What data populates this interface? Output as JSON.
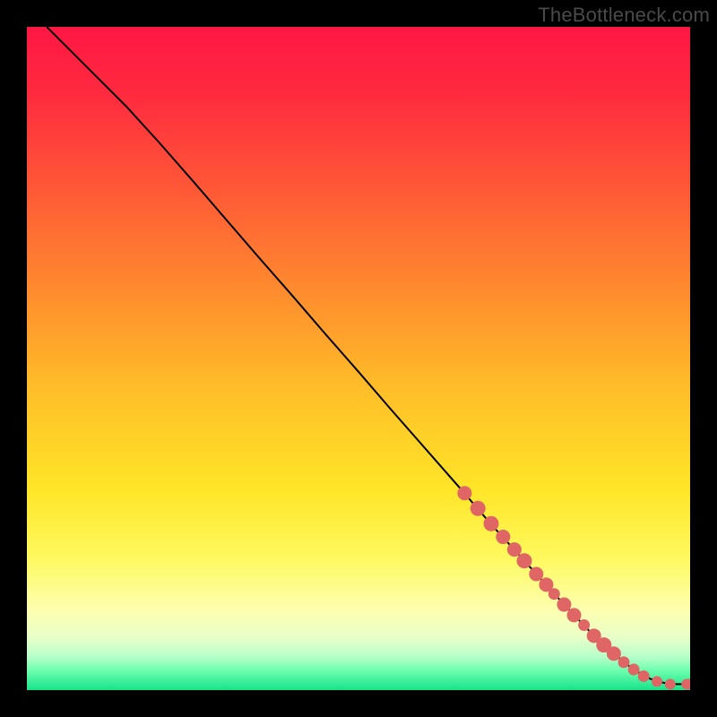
{
  "watermark": "TheBottleneck.com",
  "colors": {
    "frame": "#000000",
    "curve": "#000000",
    "marker": "#e06666",
    "gradient_stops": [
      {
        "offset": 0.0,
        "color": "#ff1744"
      },
      {
        "offset": 0.1,
        "color": "#ff2a3f"
      },
      {
        "offset": 0.25,
        "color": "#ff5a36"
      },
      {
        "offset": 0.4,
        "color": "#ff8c2e"
      },
      {
        "offset": 0.55,
        "color": "#ffbf28"
      },
      {
        "offset": 0.7,
        "color": "#ffe628"
      },
      {
        "offset": 0.8,
        "color": "#fff95e"
      },
      {
        "offset": 0.88,
        "color": "#fdffb0"
      },
      {
        "offset": 0.92,
        "color": "#e9ffc8"
      },
      {
        "offset": 0.95,
        "color": "#b7ffca"
      },
      {
        "offset": 0.97,
        "color": "#6fffb0"
      },
      {
        "offset": 1.0,
        "color": "#17e389"
      }
    ]
  },
  "chart_data": {
    "type": "line",
    "title": "",
    "xlabel": "",
    "ylabel": "",
    "xlim": [
      0,
      100
    ],
    "ylim": [
      0,
      100
    ],
    "series": [
      {
        "name": "curve",
        "x": [
          3,
          6,
          10,
          15,
          20,
          25,
          30,
          35,
          40,
          45,
          50,
          55,
          60,
          65,
          70,
          75,
          80,
          85,
          88,
          90,
          92,
          94,
          96,
          98,
          100
        ],
        "y": [
          100,
          97,
          93,
          88,
          82.5,
          76.8,
          71,
          65.2,
          59.5,
          53.7,
          48,
          42.2,
          36.5,
          30.8,
          25,
          19.5,
          14,
          8.7,
          6,
          4.2,
          2.8,
          1.7,
          1.1,
          0.9,
          0.9
        ]
      }
    ],
    "markers": [
      {
        "x": 66.0,
        "y": 29.7,
        "type": "segment-end"
      },
      {
        "x": 68.0,
        "y": 27.4,
        "type": "segment"
      },
      {
        "x": 70.0,
        "y": 25.1,
        "type": "segment"
      },
      {
        "x": 71.8,
        "y": 23.1,
        "type": "segment-end"
      },
      {
        "x": 73.5,
        "y": 21.2,
        "type": "segment-end"
      },
      {
        "x": 75.0,
        "y": 19.5,
        "type": "segment"
      },
      {
        "x": 76.8,
        "y": 17.5,
        "type": "segment-end"
      },
      {
        "x": 78.3,
        "y": 15.9,
        "type": "segment-end"
      },
      {
        "x": 79.5,
        "y": 14.5,
        "type": "dot"
      },
      {
        "x": 81.0,
        "y": 12.9,
        "type": "segment-end"
      },
      {
        "x": 82.5,
        "y": 11.3,
        "type": "segment-end"
      },
      {
        "x": 84.0,
        "y": 9.8,
        "type": "dot"
      },
      {
        "x": 85.5,
        "y": 8.2,
        "type": "segment-end"
      },
      {
        "x": 87.0,
        "y": 6.8,
        "type": "segment"
      },
      {
        "x": 88.5,
        "y": 5.5,
        "type": "segment-end"
      },
      {
        "x": 90.0,
        "y": 4.2,
        "type": "dot"
      },
      {
        "x": 91.5,
        "y": 3.1,
        "type": "dot"
      },
      {
        "x": 93.0,
        "y": 2.1,
        "type": "dot"
      },
      {
        "x": 95.0,
        "y": 1.3,
        "type": "isolated"
      },
      {
        "x": 97.0,
        "y": 0.9,
        "type": "isolated"
      },
      {
        "x": 99.5,
        "y": 0.9,
        "type": "isolated-pair"
      },
      {
        "x": 100.0,
        "y": 0.9,
        "type": "isolated-pair"
      }
    ]
  }
}
